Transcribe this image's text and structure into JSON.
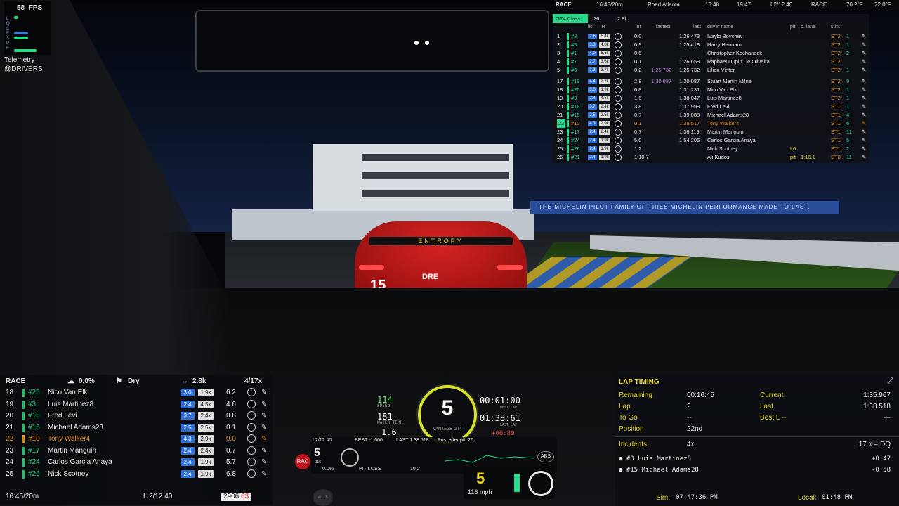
{
  "fps": {
    "value": "58",
    "label": "FPS",
    "leds": [
      "L",
      "Q",
      "C",
      "E",
      "S",
      "P",
      "F"
    ]
  },
  "telemetry": {
    "title": "Telemetry",
    "tag": "@DRIVERS"
  },
  "top_bar": {
    "session": "RACE",
    "remaining": "16:45/20m",
    "track": "Road Atlanta",
    "time1": "13:48",
    "time2": "19:47",
    "lap": "L2/12.40",
    "session2": "RACE",
    "temp1": "70.2°F",
    "temp2": "72.0°F"
  },
  "board": {
    "class_tab": "GT4 Class",
    "class_count": "26",
    "class_sof": "2.8k",
    "columns": {
      "lic": "lic",
      "ir": "iR",
      "int": "int",
      "fastest": "fastest",
      "last": "last",
      "name": "driver name",
      "pit": "pit",
      "plane": "p. lane",
      "stint": "stint"
    },
    "rows_top": [
      {
        "pos": "1",
        "num": "#2",
        "lic": "2.6",
        "ir": "5.4k",
        "int": "0.0",
        "fastest": "",
        "last": "1:26.473",
        "name": "Ivaylo Boychev",
        "stint": "ST2",
        "delta": "1"
      },
      {
        "pos": "2",
        "num": "#5",
        "lic": "3.3",
        "ir": "4.3k",
        "int": "0.9",
        "fastest": "",
        "last": "1:25.418",
        "name": "Harry Hannam",
        "stint": "ST2",
        "delta": "1"
      },
      {
        "pos": "3",
        "num": "#1",
        "lic": "4.0",
        "ir": "6.6k",
        "int": "0.6",
        "fastest": "",
        "last": "",
        "name": "Christopher Kochaneck",
        "stint": "ST2",
        "delta": "2"
      },
      {
        "pos": "4",
        "num": "#7",
        "lic": "2.7",
        "ir": "3.6k",
        "int": "0.1",
        "fastest": "",
        "last": "1:26.658",
        "name": "Raphael Dupin De Oliveira",
        "stint": "ST2",
        "delta": ""
      },
      {
        "pos": "5",
        "num": "#6",
        "lic": "3.3",
        "ir": "3.7k",
        "int": "0.2",
        "fastest": "1:25.732",
        "last": "1:25.732",
        "name": "Lilian Vinter",
        "stint": "ST2",
        "delta": "1"
      }
    ],
    "rows_bottom": [
      {
        "pos": "17",
        "num": "#19",
        "lic": "4.4",
        "ir": "2.2k",
        "int": "2.8",
        "fastest": "1:30.087",
        "last": "1:30.087",
        "name": "Stuart Martin Milne",
        "pit": "",
        "stint": "ST2",
        "delta": "9"
      },
      {
        "pos": "18",
        "num": "#25",
        "lic": "3.0",
        "ir": "1.9k",
        "int": "0.8",
        "fastest": "",
        "last": "1:31.231",
        "name": "Nico Van Elk",
        "pit": "",
        "stint": "ST2",
        "delta": "1"
      },
      {
        "pos": "19",
        "num": "#3",
        "lic": "2.4",
        "ir": "4.5k",
        "int": "1.6",
        "fastest": "",
        "last": "1:38.047",
        "name": "Luis Martinez8",
        "pit": "",
        "stint": "ST2",
        "delta": "1"
      },
      {
        "pos": "20",
        "num": "#18",
        "lic": "3.7",
        "ir": "2.4k",
        "int": "3.8",
        "fastest": "",
        "last": "1:37.998",
        "name": "Fred Levi",
        "pit": "",
        "stint": "ST1",
        "delta": "1"
      },
      {
        "pos": "21",
        "num": "#15",
        "lic": "2.5",
        "ir": "2.5k",
        "int": "0.7",
        "fastest": "",
        "last": "1:39.088",
        "name": "Michael Adams28",
        "pit": "",
        "stint": "ST1",
        "delta": "4"
      },
      {
        "pos": "22",
        "num": "#10",
        "lic": "4.3",
        "ir": "2.9k",
        "int": "0.1",
        "fastest": "",
        "last": "1:38.517",
        "name": "Tony Walker4",
        "pit": "",
        "stint": "ST1",
        "delta": "6"
      },
      {
        "pos": "23",
        "num": "#17",
        "lic": "2.4",
        "ir": "2.4k",
        "int": "0.7",
        "fastest": "",
        "last": "1:36.119",
        "name": "Martin Manguin",
        "pit": "",
        "stint": "ST1",
        "delta": "11"
      },
      {
        "pos": "24",
        "num": "#24",
        "lic": "2.4",
        "ir": "1.9k",
        "int": "5.0",
        "fastest": "",
        "last": "1:54.206",
        "name": "Carlos Garcia Anaya",
        "pit": "",
        "stint": "ST1",
        "delta": "5"
      },
      {
        "pos": "25",
        "num": "#26",
        "lic": "2.4",
        "ir": "1.9k",
        "int": "1.2",
        "fastest": "",
        "last": "",
        "name": "Nick Scotney",
        "pit": "L0",
        "stint": "ST1",
        "delta": "2"
      },
      {
        "pos": "26",
        "num": "#21",
        "lic": "2.4",
        "ir": "1.9k",
        "int": "1:10.7",
        "fastest": "",
        "last": "",
        "name": "Ali Kudos",
        "pit": "pit",
        "plane": "1:16.1",
        "stint": "ST0",
        "delta": "11"
      }
    ]
  },
  "standings": {
    "session": "RACE",
    "humidity": "0.0%",
    "weather": "Dry",
    "sof": "2.8k",
    "pages": "4/17x",
    "rows": [
      {
        "pos": "18",
        "num": "#25",
        "name": "Nico Van Elk",
        "lic": "3.0",
        "ir": "1.9k",
        "gap": "6.2",
        "bar": "#1fbf6b"
      },
      {
        "pos": "19",
        "num": "#3",
        "name": "Luis Martinez8",
        "lic": "2.4",
        "ir": "4.5k",
        "gap": "4.6",
        "bar": "#1fbf6b"
      },
      {
        "pos": "20",
        "num": "#18",
        "name": "Fred Levi",
        "lic": "3.7",
        "ir": "2.4k",
        "gap": "0.8",
        "bar": "#1fbf6b"
      },
      {
        "pos": "21",
        "num": "#15",
        "name": "Michael Adams28",
        "lic": "2.5",
        "ir": "2.5k",
        "gap": "0.1",
        "bar": "#1fbf6b"
      },
      {
        "pos": "22",
        "num": "#10",
        "name": "Tony Walker4",
        "lic": "4.3",
        "ir": "2.9k",
        "gap": "0.0",
        "bar": "#e08a1e"
      },
      {
        "pos": "23",
        "num": "#17",
        "name": "Martin Manguin",
        "lic": "2.4",
        "ir": "2.4k",
        "gap": "0.7",
        "bar": "#1fbf6b"
      },
      {
        "pos": "24",
        "num": "#24",
        "name": "Carlos Garcia Anaya",
        "lic": "2.4",
        "ir": "1.9k",
        "gap": "5.7",
        "bar": "#1fbf6b"
      },
      {
        "pos": "25",
        "num": "#26",
        "name": "Nick Scotney",
        "lic": "2.4",
        "ir": "1.9k",
        "gap": "6.8",
        "bar": "#1fbf6b"
      }
    ],
    "footer_time": "16:45/20m",
    "footer_lap": "L 2/12.40",
    "footer_rating": "2906",
    "footer_delta": "63"
  },
  "lap_timing": {
    "title": "LAP TIMING",
    "remaining_label": "Remaining",
    "remaining": "00:16:45",
    "lap_label": "Lap",
    "lap": "2",
    "togo_label": "To Go",
    "togo": "--",
    "position_label": "Position",
    "position": "22nd",
    "current_label": "Current",
    "current": "1:35.967",
    "last_label": "Last",
    "last": "1:38.518",
    "best_label": "Best L --",
    "best": "---",
    "incidents_label": "Incidents",
    "incidents": "4x",
    "incident_limit": "17 x = DQ",
    "relatives": [
      {
        "name": "#3 Luis Martinez8",
        "delta": "+0.47"
      },
      {
        "name": "#15 Michael Adams28",
        "delta": "-0.58"
      }
    ],
    "sim_label": "Sim:",
    "sim_time": "07:47:36 PM",
    "local_label": "Local:",
    "local_time": "01:48 PM"
  },
  "dash": {
    "speed": "114",
    "speed_label": "SPEED",
    "rpm": "181",
    "rpm_label": "WATER TEMP",
    "extra": "1.6",
    "gear": "5",
    "brand": "VANTAGE GT4",
    "best_lap_time": "00:01:00",
    "best_lap_label": "BEST LAP",
    "last_lap_time": "01:38:61",
    "last_lap_label": "LAST LAP",
    "delta": "+06:89"
  },
  "midbar": {
    "lap": "L2/12.40",
    "best": "BEST -1.000",
    "last": "LAST 1:38.518",
    "pos_after_pit": "Pos. after pit: 26",
    "gear": "5",
    "gear_sub": "116",
    "fuel": "0.0%",
    "pit_loss": "PIT LOSS",
    "fuel2": "10.2",
    "abs": "ABS"
  },
  "speedo": {
    "gear": "5",
    "speed": "116 mph"
  },
  "scene": {
    "banner": "THE MICHELIN PILOT FAMILY OF TIRES  MICHELIN  PERFORMANCE MADE TO LAST.",
    "car_number": "15",
    "car_sponsor": "DRE",
    "car_wing": "ENTROPY",
    "aux": "AUX",
    "rac": "RAC"
  },
  "colors": {
    "accent": "#27d98a",
    "orange": "#e08a1e",
    "yellow": "#d7e02a",
    "red": "#e23b3b"
  }
}
